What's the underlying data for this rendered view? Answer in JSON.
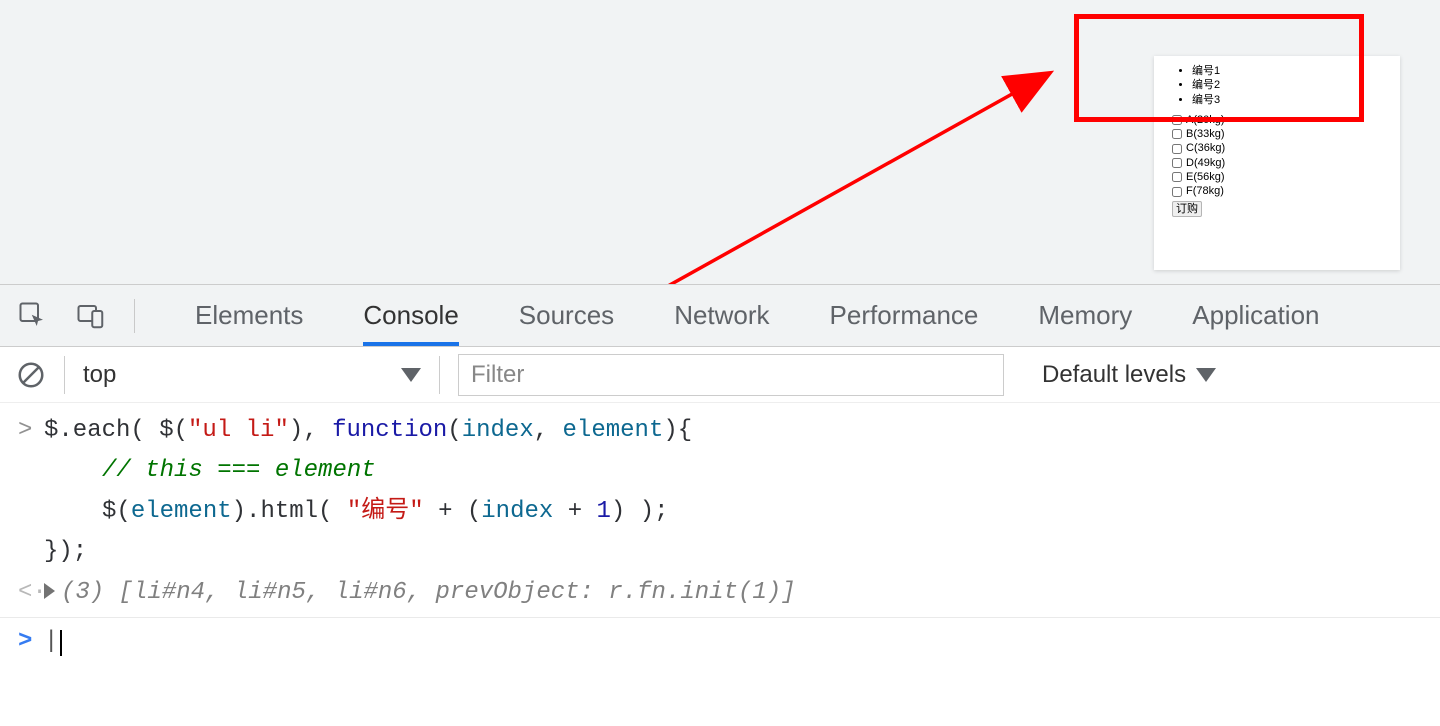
{
  "preview": {
    "bullets": [
      "编号1",
      "编号2",
      "编号3"
    ],
    "checkboxes": [
      "A(20kg)",
      "B(33kg)",
      "C(36kg)",
      "D(49kg)",
      "E(56kg)",
      "F(78kg)"
    ],
    "button_label": "订购"
  },
  "devtools": {
    "tabs": {
      "elements": "Elements",
      "console": "Console",
      "sources": "Sources",
      "network": "Network",
      "performance": "Performance",
      "memory": "Memory",
      "application": "Application"
    },
    "active_tab": "console",
    "toolbar": {
      "context": "top",
      "filter_placeholder": "Filter",
      "levels_label": "Default levels"
    },
    "code": {
      "line1_a": "$.each( $(",
      "line1_str": "\"ul li\"",
      "line1_b": "), ",
      "line1_fn": "function",
      "line1_c": "(",
      "line1_p1": "index",
      "line1_d": ", ",
      "line1_p2": "element",
      "line1_e": "){",
      "line2": "// this === element",
      "line3_a": "$(",
      "line3_p": "element",
      "line3_b": ").html( ",
      "line3_str": "\"编号\"",
      "line3_c": " + (",
      "line3_p2": "index",
      "line3_d": " + ",
      "line3_num": "1",
      "line3_e": ") );",
      "line4": "});"
    },
    "output": {
      "count": "(3)",
      "open": " [",
      "i1": "li#n4",
      "sep": ", ",
      "i2": "li#n5",
      "i3": "li#n6",
      "rest": "prevObject: r.fn.init(1)",
      "close": "]"
    }
  }
}
